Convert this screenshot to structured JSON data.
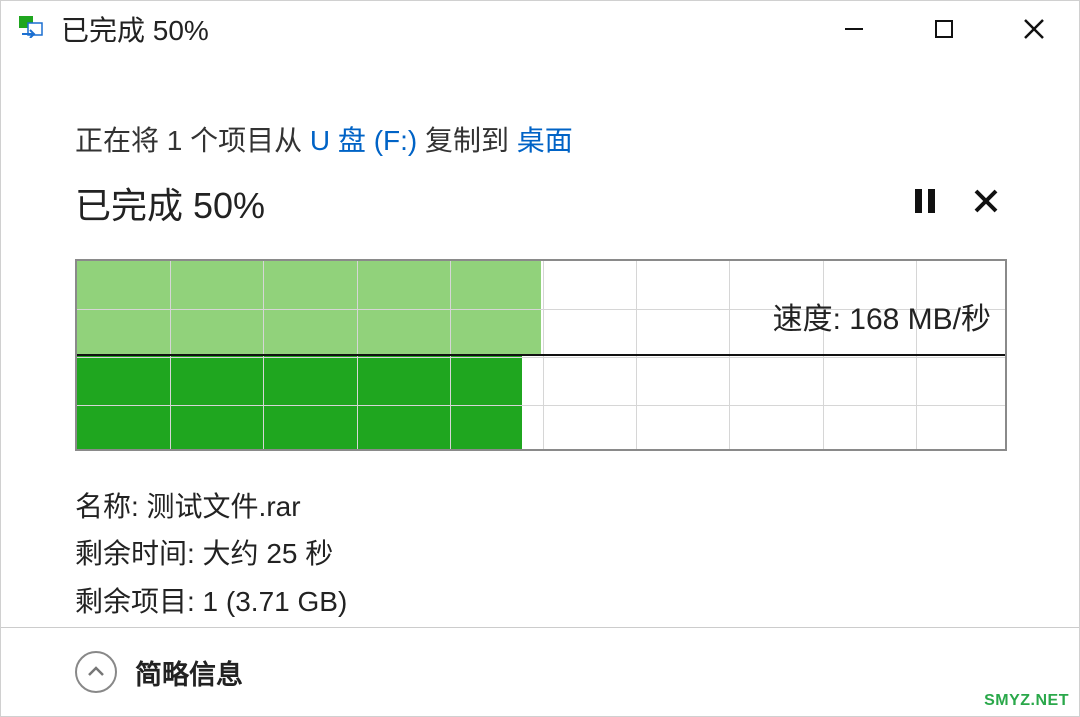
{
  "title": "已完成 50%",
  "operation": {
    "prefix": "正在将 1 个项目从 ",
    "source": "U 盘 (F:)",
    "mid": " 复制到 ",
    "dest": "桌面"
  },
  "status": "已完成 50%",
  "speed_label": "速度: 168 MB/秒",
  "chart_data": {
    "type": "area",
    "progress_percent": 50,
    "fill_top_percent": 50,
    "fill_bottom_percent": 48,
    "grid_cols": 10,
    "grid_rows": 4
  },
  "details": {
    "name_row": "名称: 测试文件.rar",
    "time_row": "剩余时间: 大约 25 秒",
    "items_row": "剩余项目: 1 (3.71 GB)"
  },
  "footer_toggle": "简略信息",
  "watermark": "SMYZ.NET"
}
